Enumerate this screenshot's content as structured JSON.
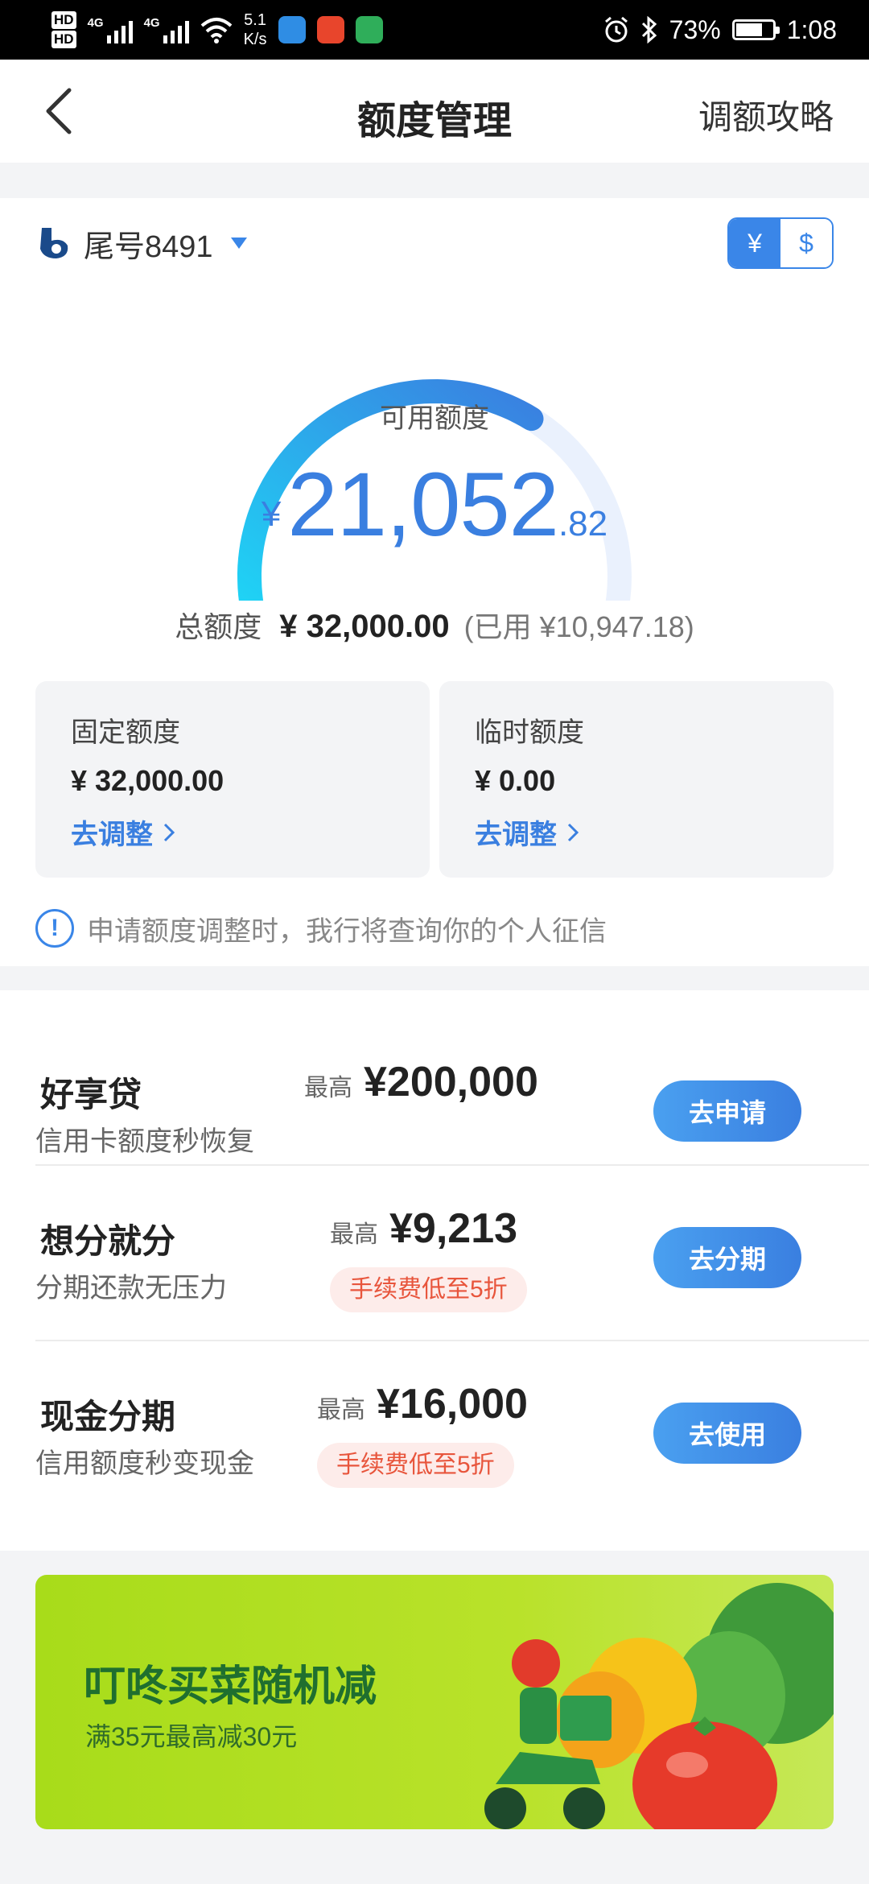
{
  "status_bar": {
    "hd1": "HD",
    "hd2": "HD",
    "net1": "4G",
    "net2": "4G",
    "speed_value": "5.1",
    "speed_unit": "K/s",
    "battery": "73%",
    "battery_level": 0.73,
    "time": "1:08"
  },
  "nav": {
    "title": "额度管理",
    "action": "调额攻略"
  },
  "card": {
    "label": "尾号8491"
  },
  "currency": {
    "rmb": "¥",
    "usd": "$",
    "selected": "rmb"
  },
  "gauge": {
    "used_fraction": 0.658,
    "colors": {
      "start": "#1fd3f5",
      "end": "#3a7fe0",
      "track": "#eaf1fd"
    }
  },
  "available": {
    "label": "可用额度",
    "symbol": "¥",
    "integer": "21,052",
    "decimal": ".82"
  },
  "total": {
    "label": "总额度",
    "value": "¥ 32,000.00",
    "used_text": "(已用 ¥10,947.18)"
  },
  "fixed": {
    "title": "固定额度",
    "value": "¥ 32,000.00",
    "action": "去调整"
  },
  "temporary": {
    "title": "临时额度",
    "value": "¥ 0.00",
    "action": "去调整"
  },
  "notice": {
    "icon": "!",
    "text": "申请额度调整时，我行将查询你的个人征信"
  },
  "products": [
    {
      "name": "好享贷",
      "desc": "信用卡额度秒恢复",
      "max_label": "最高",
      "max_value": "¥200,000",
      "tag": "",
      "button": "去申请"
    },
    {
      "name": "想分就分",
      "desc": "分期还款无压力",
      "max_label": "最高",
      "max_value": "¥9,213",
      "tag": "手续费低至5折",
      "button": "去分期"
    },
    {
      "name": "现金分期",
      "desc": "信用额度秒变现金",
      "max_label": "最高",
      "max_value": "¥16,000",
      "tag": "手续费低至5折",
      "button": "去使用"
    }
  ],
  "banner": {
    "title": "叮咚买菜随机减",
    "subtitle": "满35元最高减30元"
  },
  "colors": {
    "accent": "#3a7fe0",
    "tag_text": "#e8553c",
    "tag_bg": "#fdecea"
  }
}
